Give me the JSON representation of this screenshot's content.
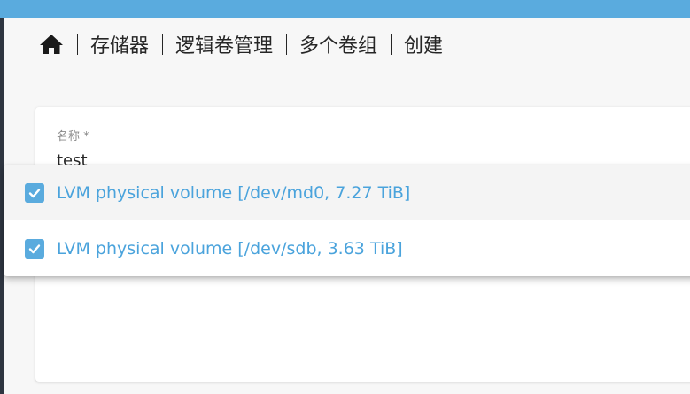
{
  "breadcrumb": {
    "home_icon": "home-icon",
    "items": [
      "存储器",
      "逻辑卷管理",
      "多个卷组",
      "创建"
    ]
  },
  "form": {
    "name_label": "名称 *",
    "name_value": "test"
  },
  "dropdown": {
    "options": [
      {
        "label": "LVM physical volume [/dev/md0, 7.27 TiB]",
        "checked": true
      },
      {
        "label": "LVM physical volume [/dev/sdb, 3.63 TiB]",
        "checked": true
      }
    ]
  },
  "colors": {
    "top_bar": "#5aabde",
    "accent": "#4aa3dc",
    "checkbox": "#5aabde"
  }
}
